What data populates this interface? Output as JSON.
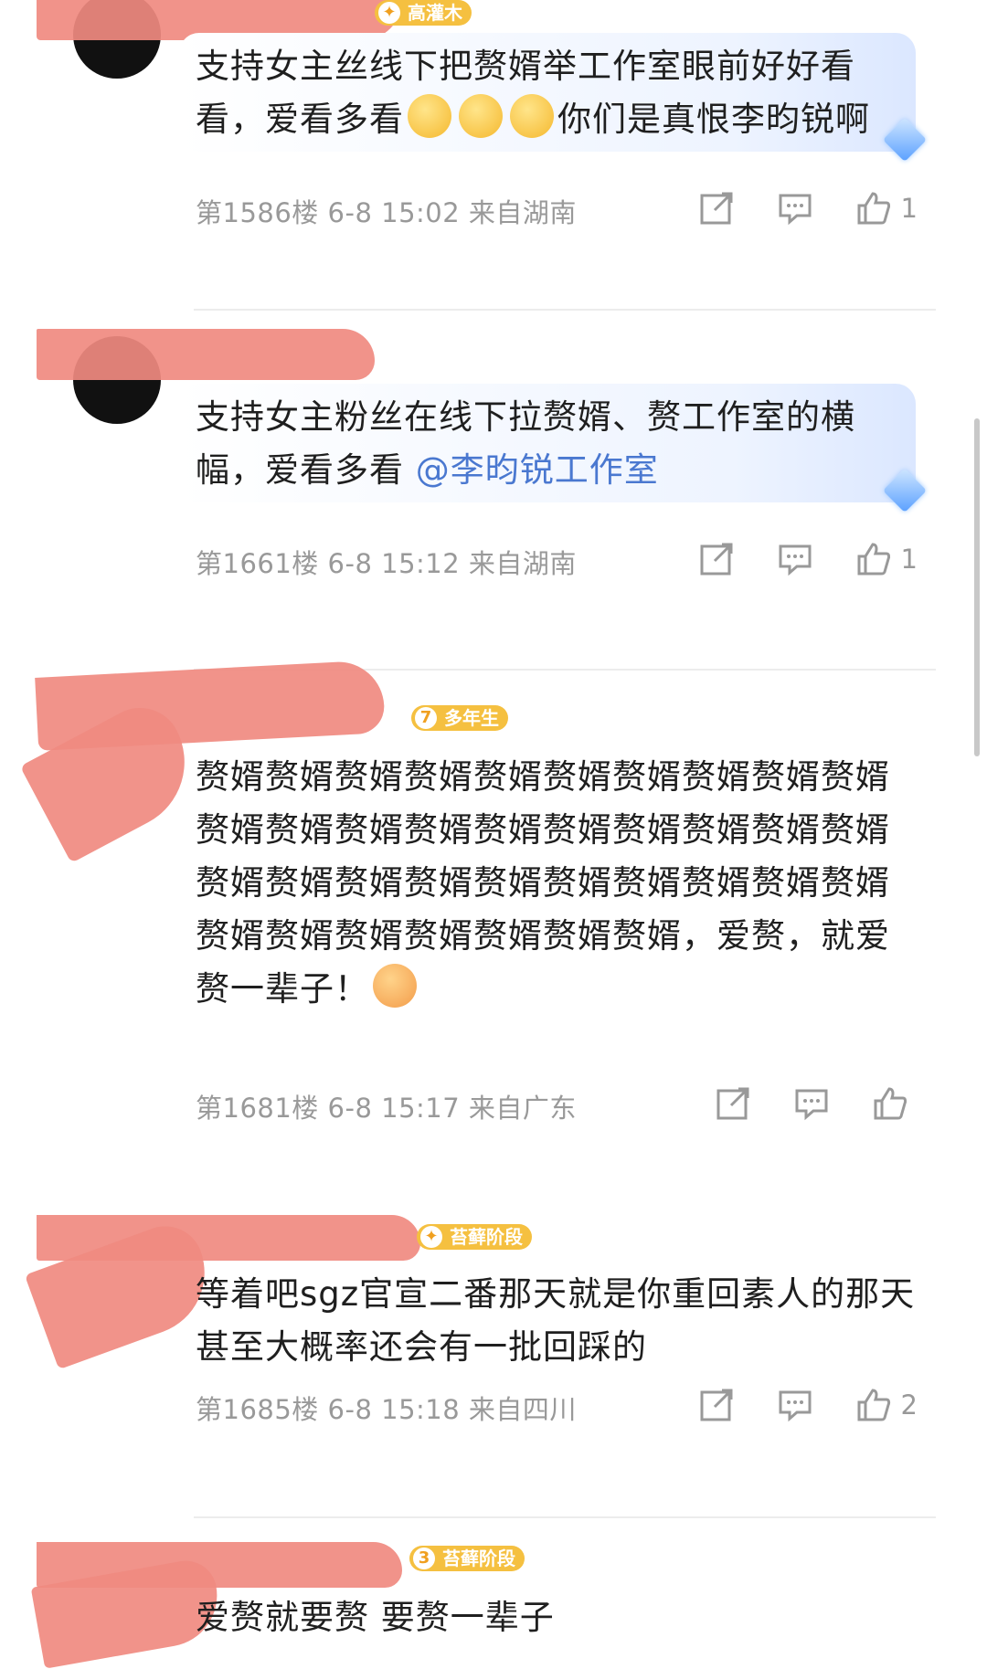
{
  "comments": [
    {
      "badge": "高灌木",
      "text_a": "支持女主丝线下把赘婿举工作室眼前好好看看，爱看多看",
      "text_b": "你们是真恨李昀锐啊",
      "floor": "第1586楼",
      "time": "6-8 15:02",
      "location": "来自湖南",
      "likes": "1"
    },
    {
      "text_a": "支持女主粉丝在线下拉赘婿、赘工作室的横幅，爱看多看 ",
      "mention": "@李昀锐工作室",
      "floor": "第1661楼",
      "time": "6-8 15:12",
      "location": "来自湖南",
      "likes": "1"
    },
    {
      "badge_level": "7",
      "badge": "多年生",
      "text_a": "赘婿赘婿赘婿赘婿赘婿赘婿赘婿赘婿赘婿赘婿赘婿赘婿赘婿赘婿赘婿赘婿赘婿赘婿赘婿赘婿赘婿赘婿赘婿赘婿赘婿赘婿赘婿赘婿赘婿赘婿赘婿赘婿赘婿赘婿赘婿赘婿赘婿，爱赘，就爱赘一辈子！",
      "floor": "第1681楼",
      "time": "6-8 15:17",
      "location": "来自广东",
      "likes": ""
    },
    {
      "badge": "苔藓阶段",
      "text_a": "等着吧sgz官宣二番那天就是你重回素人的那天 甚至大概率还会有一批回踩的",
      "floor": "第1685楼",
      "time": "6-8 15:18",
      "location": "来自四川",
      "likes": "2"
    },
    {
      "badge_level": "3",
      "badge": "苔藓阶段",
      "text_a": "爱赘就要赘 要赘一辈子"
    }
  ],
  "icons": {
    "share": "share-icon",
    "comment": "comment-icon",
    "like": "thumbs-up-icon"
  },
  "colors": {
    "mention": "#4a78d0",
    "meta": "#999999",
    "badge": "#f5c040",
    "redaction": "#f08a80"
  }
}
